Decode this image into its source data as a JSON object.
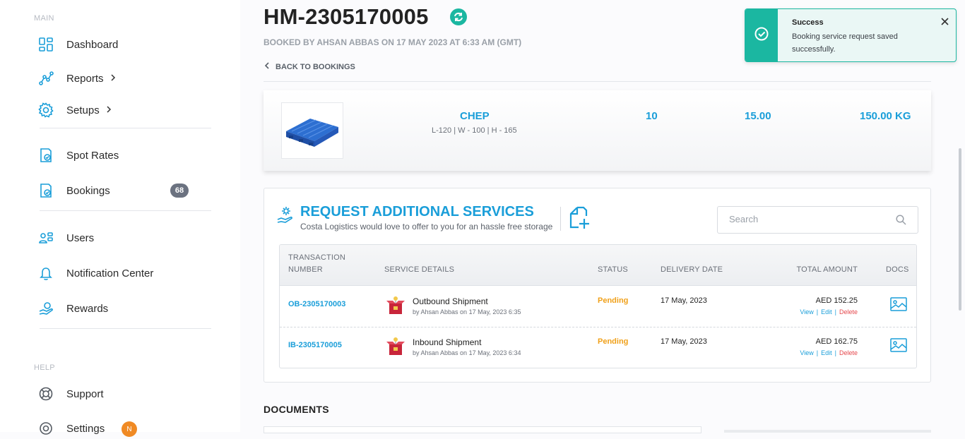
{
  "sidebar": {
    "main_label": "MAIN",
    "help_label": "HELP",
    "items": [
      {
        "label": "Dashboard",
        "icon": "dashboard-icon"
      },
      {
        "label": "Reports",
        "icon": "reports-icon"
      },
      {
        "label": "Setups",
        "icon": "gear-icon"
      },
      {
        "label": "Spot Rates",
        "icon": "spot-rates-icon"
      },
      {
        "label": "Bookings",
        "icon": "bookings-icon",
        "badge": "68"
      },
      {
        "label": "Users",
        "icon": "users-icon"
      },
      {
        "label": "Notification Center",
        "icon": "bell-icon"
      },
      {
        "label": "Rewards",
        "icon": "rewards-icon"
      }
    ],
    "help_items": [
      {
        "label": "Support",
        "icon": "support-icon"
      },
      {
        "label": "Settings",
        "icon": "gear-icon",
        "badge": "N"
      }
    ]
  },
  "header": {
    "title": "HM-2305170005",
    "subtitle": "BOOKED BY AHSAN ABBAS ON 17 MAY 2023 AT 6:33 AM (GMT)",
    "back_label": "BACK TO BOOKINGS"
  },
  "pallet": {
    "name": "CHEP",
    "dims": "L-120 | W - 100 | H - 165",
    "qty": "10",
    "unit_weight": "15.00",
    "total_weight": "150.00 KG"
  },
  "services": {
    "title": "REQUEST ADDITIONAL SERVICES",
    "subtitle": "Costa Logistics would love to offer to you for an hassle free storage",
    "search_placeholder": "Search",
    "columns": {
      "txn1": "TRANSACTION",
      "txn2": "NUMBER",
      "details": "SERVICE DETAILS",
      "status": "STATUS",
      "delivery": "DELIVERY DATE",
      "amount": "TOTAL AMOUNT",
      "docs": "DOCS"
    },
    "rows": [
      {
        "txn": "OB-2305170003",
        "service": "Outbound Shipment",
        "by": "by Ahsan Abbas on 17 May, 2023 6:35",
        "status": "Pending",
        "date": "17 May, 2023",
        "amount": "AED 152.25"
      },
      {
        "txn": "IB-2305170005",
        "service": "Inbound Shipment",
        "by": "by Ahsan Abbas on 17 May, 2023 6:34",
        "status": "Pending",
        "date": "17 May, 2023",
        "amount": "AED 162.75"
      }
    ],
    "actions": {
      "view": "View",
      "edit": "Edit",
      "delete": "Delete",
      "sep": "|"
    }
  },
  "documents": {
    "title": "DOCUMENTS"
  },
  "toast": {
    "title": "Success",
    "message": "Booking service request saved successfully."
  },
  "colors": {
    "accent": "#1a9ed9",
    "success": "#1bb7a1",
    "pending": "#f0a019",
    "danger": "#e5484d"
  }
}
